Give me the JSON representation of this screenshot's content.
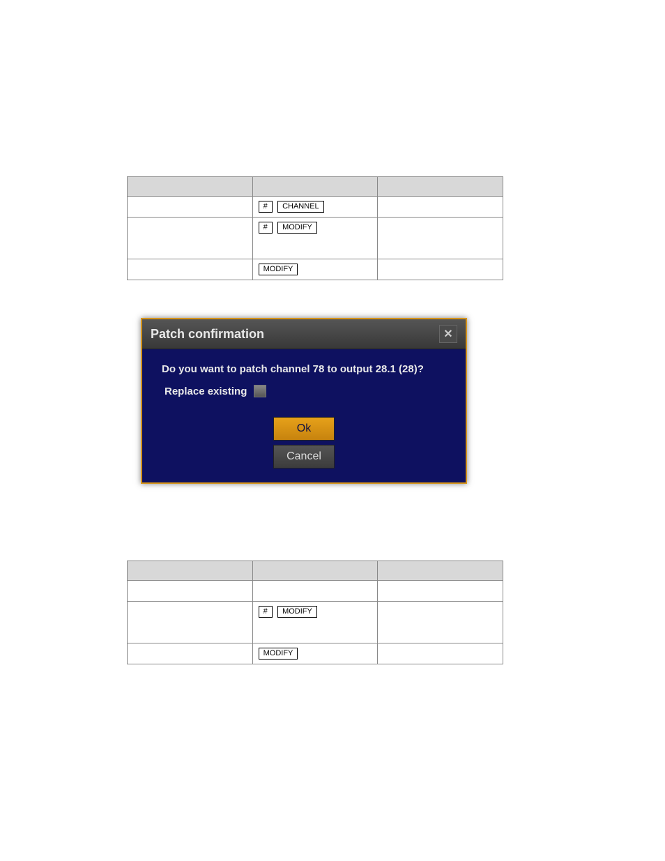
{
  "tables": {
    "top": {
      "rows": [
        {
          "col1": "",
          "col2_keys": [
            "#",
            "CHANNEL"
          ],
          "col3": ""
        },
        {
          "col1": "",
          "col2_keys": [
            "#",
            "MODIFY"
          ],
          "col3": ""
        },
        {
          "col1": "",
          "col2_keys": [
            "MODIFY"
          ],
          "col3": ""
        }
      ]
    },
    "bottom": {
      "rows": [
        {
          "col1": "",
          "col2_keys": [],
          "col3": ""
        },
        {
          "col1": "",
          "col2_keys": [
            "#",
            "MODIFY"
          ],
          "col3": ""
        },
        {
          "col1": "",
          "col2_keys": [
            "MODIFY"
          ],
          "col3": ""
        }
      ]
    }
  },
  "dialog": {
    "title": "Patch confirmation",
    "question": "Do you want to patch channel 78 to output 28.1 (28)?",
    "replace_label": "Replace existing",
    "ok_label": "Ok",
    "cancel_label": "Cancel"
  }
}
